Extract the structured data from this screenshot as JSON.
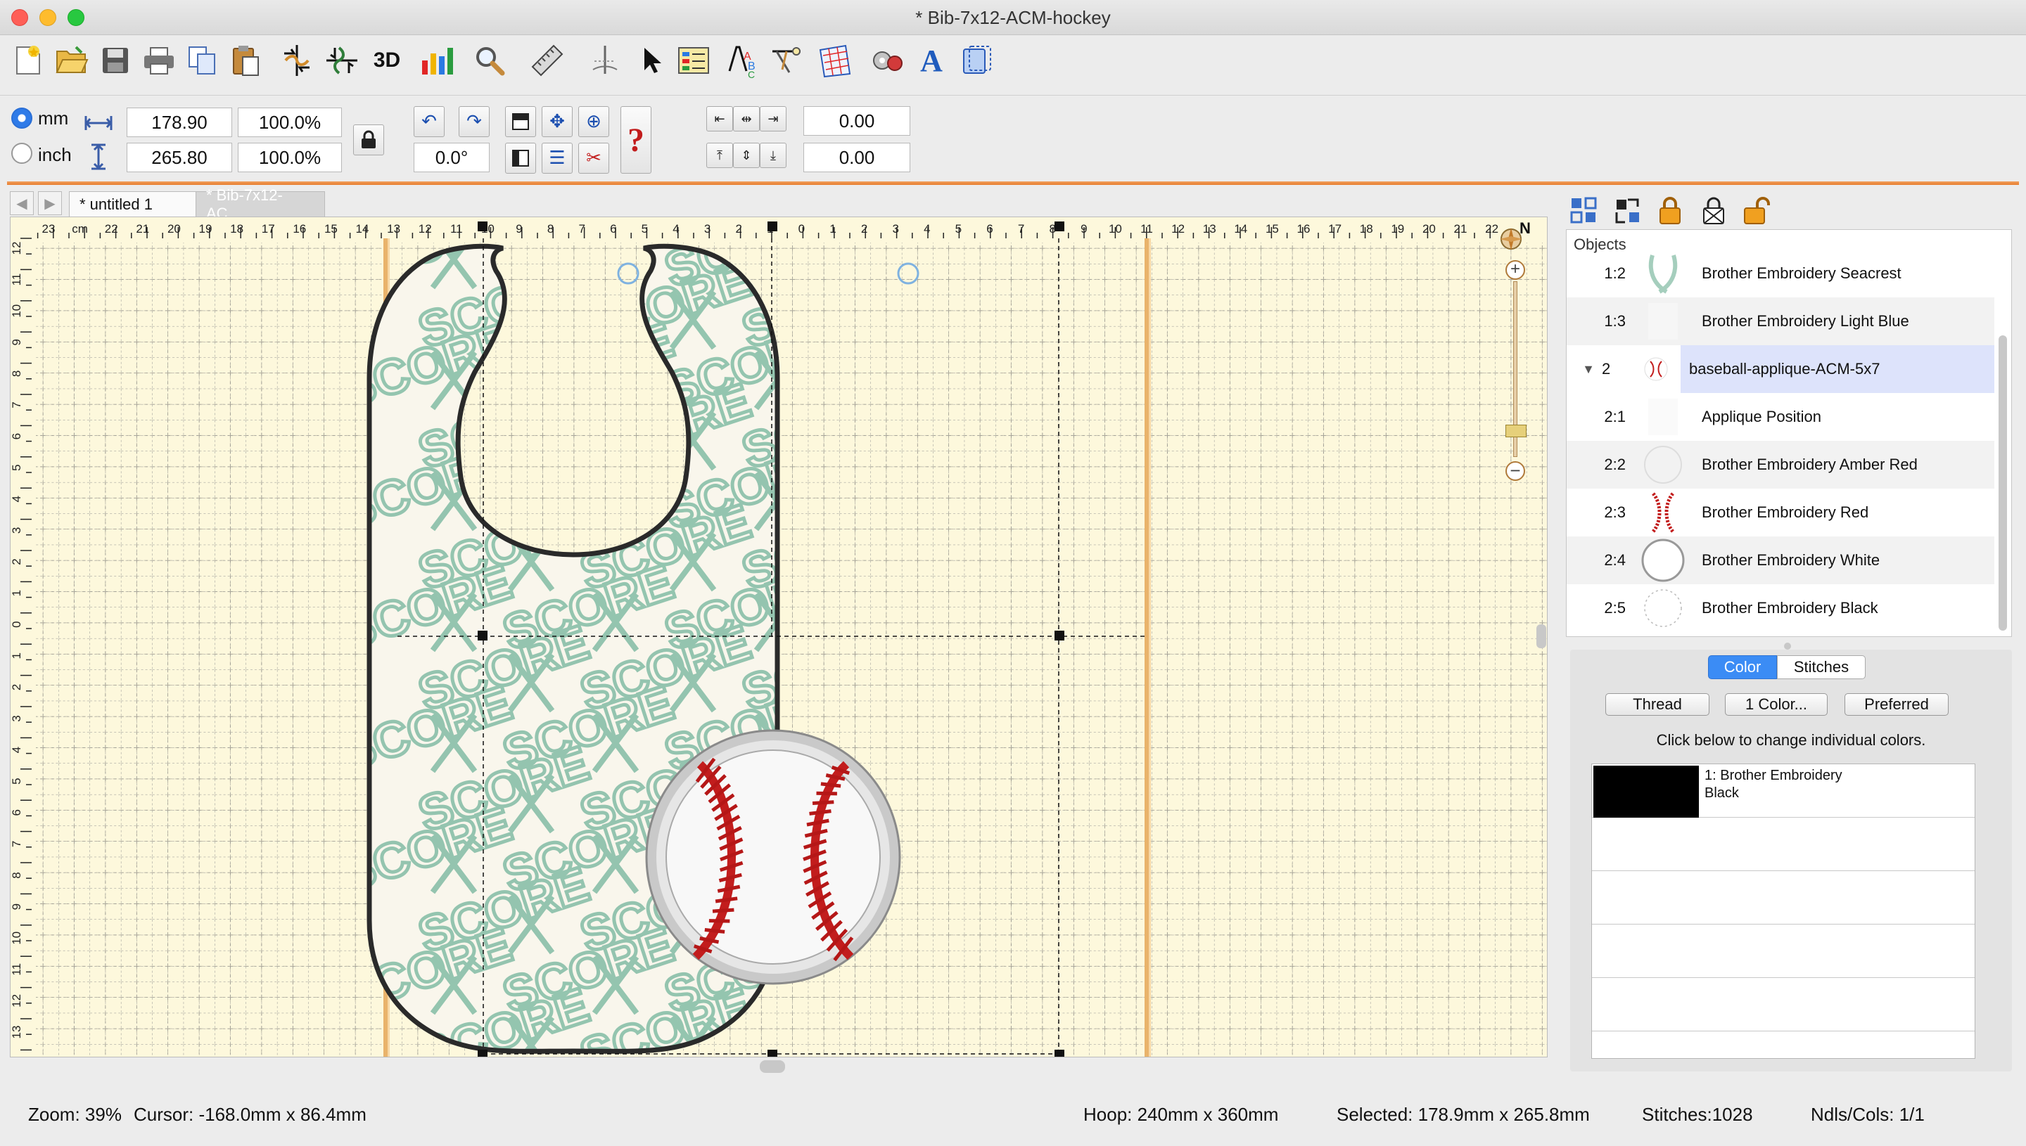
{
  "window": {
    "title": "* Bib-7x12-ACM-hockey",
    "controls": {
      "close_color": "#fe5f57",
      "minimize_color": "#febc2e",
      "zoom_color": "#28c840"
    }
  },
  "toolbar": {
    "icons": [
      "new-file-icon",
      "open-folder-icon",
      "save-icon",
      "print-icon",
      "copy-icon",
      "paste-icon",
      "mirror-horizontal-icon",
      "mirror-vertical-icon",
      "3d-view-icon",
      "stitch-chart-icon",
      "magnifier-icon",
      "ruler-icon",
      "needle-icon",
      "pointer-icon",
      "object-properties-icon",
      "lettering-icon",
      "applique-icon",
      "fill-pattern-icon",
      "thread-settings-icon",
      "text-tool-icon",
      "hoop-icon"
    ],
    "threed_label": "3D",
    "text_tool_label": "A"
  },
  "propbar": {
    "units": {
      "mm_label": "mm",
      "inch_label": "inch",
      "selected": "mm"
    },
    "width_value": "178.90",
    "width_percent": "100.0%",
    "height_value": "265.80",
    "height_percent": "100.0%",
    "rotation_value": "0.0°",
    "x_offset": "0.00",
    "y_offset": "0.00"
  },
  "tabs": {
    "back_arrow": "◀",
    "forward_arrow": "▶",
    "items": [
      {
        "label": "* untitled 1",
        "active": true
      },
      {
        "label": "* Bib-7x12-AC...",
        "active": false
      }
    ]
  },
  "canvas": {
    "grid_color": "#fdf8dc",
    "ruler_top_labels": [
      "23",
      "cm",
      "22",
      "21",
      "20",
      "19",
      "18",
      "17",
      "16",
      "15",
      "14",
      "13",
      "12",
      "11",
      "10",
      "9",
      "8",
      "7",
      "6",
      "5",
      "4",
      "3",
      "2",
      "1",
      "0",
      "1",
      "2",
      "3",
      "4",
      "5",
      "6",
      "7",
      "8",
      "9",
      "10",
      "11",
      "12",
      "13",
      "14",
      "15",
      "16",
      "17",
      "18",
      "19",
      "20",
      "21",
      "22"
    ],
    "ruler_left_labels": [
      "12",
      "11",
      "10",
      "9",
      "8",
      "7",
      "6",
      "5",
      "4",
      "3",
      "2",
      "1",
      "0",
      "1",
      "2",
      "3",
      "4",
      "5",
      "6",
      "7",
      "8",
      "9",
      "10",
      "11",
      "12",
      "13"
    ],
    "hoop_guide_color": "#e9b36b",
    "bib_outline_color": "#2a2a2a",
    "pattern_text": "SCORE",
    "pattern_color": "#8fc2ac",
    "baseball_stitch_color": "#c21d1d",
    "compass_label": "N"
  },
  "objects_panel": {
    "label": "Objects",
    "header_icons": [
      "group-icon",
      "ungroup-icon",
      "lock-icon",
      "lock-crossed-icon",
      "unlock-icon"
    ],
    "rows": [
      {
        "id": "1:2",
        "name": "Brother Embroidery Seacrest",
        "thumb": "seacrest-thumb"
      },
      {
        "id": "1:3",
        "name": "Brother Embroidery Light Blue",
        "thumb": "lightblue-thumb"
      },
      {
        "id": "2",
        "name": "baseball-applique-ACM-5x7",
        "thumb": "baseball-thumb",
        "expander": "▼",
        "selected": true
      },
      {
        "id": "2:1",
        "name": "Applique Position",
        "thumb": "applique-thumb"
      },
      {
        "id": "2:2",
        "name": "Brother Embroidery Amber Red",
        "thumb": "amberred-thumb"
      },
      {
        "id": "2:3",
        "name": "Brother Embroidery Red",
        "thumb": "red-thumb"
      },
      {
        "id": "2:4",
        "name": "Brother Embroidery White",
        "thumb": "white-thumb"
      },
      {
        "id": "2:5",
        "name": "Brother Embroidery Black",
        "thumb": "black-thumb"
      }
    ]
  },
  "color_panel": {
    "tabs": [
      "Color",
      "Stitches"
    ],
    "active_tab": "Color",
    "buttons": {
      "thread": "Thread",
      "one_color": "1 Color...",
      "preferred": "Preferred"
    },
    "hint": "Click below to change individual colors.",
    "colors": [
      {
        "swatch": "#000000",
        "line1": "1: Brother Embroidery",
        "line2": "Black"
      }
    ]
  },
  "status": {
    "zoom": "Zoom: 39%",
    "cursor": "Cursor: -168.0mm x 86.4mm",
    "hoop": "Hoop: 240mm x 360mm",
    "selected": "Selected: 178.9mm x 265.8mm",
    "stitches": "Stitches:1028",
    "needles": "Ndls/Cols: 1/1"
  }
}
